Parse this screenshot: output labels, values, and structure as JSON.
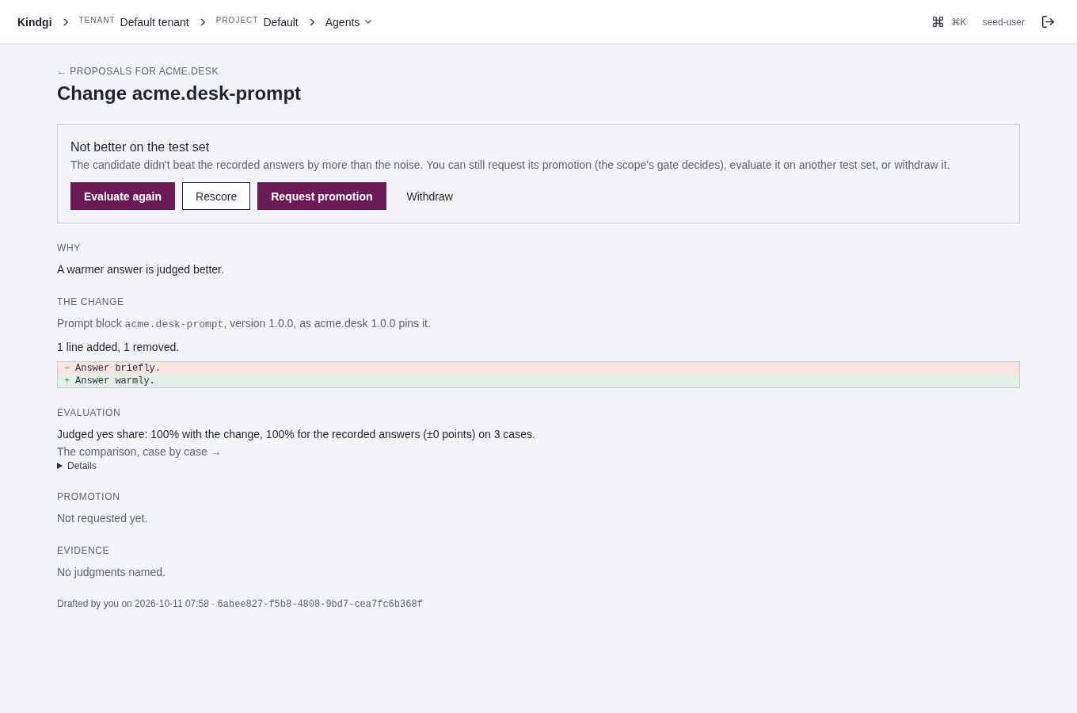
{
  "header": {
    "brand": "Kindgi",
    "breadcrumbs": [
      {
        "kind": "scoped",
        "label": "TENANT",
        "value": "Default tenant"
      },
      {
        "kind": "scoped",
        "label": "PROJECT",
        "value": "Default"
      },
      {
        "kind": "menu",
        "value": "Agents"
      }
    ],
    "shortcut": "⌘K",
    "user": "seed-user"
  },
  "back_link": "← PROPOSALS FOR ACME.DESK",
  "title": "Change acme.desk-prompt",
  "notice": {
    "title": "Not better on the test set",
    "text": "The candidate didn't beat the recorded answers by more than the noise. You can still request its promotion (the scope's gate decides), evaluate it on another test set, or withdraw it.",
    "buttons": [
      {
        "label": "Evaluate again",
        "kind": "primary"
      },
      {
        "label": "Rescore",
        "kind": "outline"
      },
      {
        "label": "Request promotion",
        "kind": "primary"
      },
      {
        "label": "Withdraw",
        "kind": "plain"
      }
    ]
  },
  "sections": [
    {
      "heading": "WHY",
      "kind": "text",
      "text": "A warmer answer is judged better."
    },
    {
      "heading": "THE CHANGE",
      "kind": "change",
      "description": [
        {
          "text": "Prompt block ",
          "code": false
        },
        {
          "text": "acme.desk-prompt",
          "code": true
        },
        {
          "text": ", version 1.0.0, as acme.desk 1.0.0 pins it.",
          "code": false
        }
      ],
      "summary": "1 line added, 1 removed.",
      "diff": [
        {
          "kind": "removed",
          "sign": "−",
          "text": "Answer briefly."
        },
        {
          "kind": "added",
          "sign": "+",
          "text": "Answer warmly."
        }
      ]
    },
    {
      "heading": "EVALUATION",
      "kind": "evaluation",
      "text": "Judged yes share: 100% with the change, 100% for the recorded answers (±0 points) on 3 cases.",
      "link": "The comparison, case by case →",
      "details": {
        "label": "Details",
        "expanded": false
      }
    },
    {
      "heading": "PROMOTION",
      "kind": "empty",
      "text": "Not requested yet."
    },
    {
      "heading": "EVIDENCE",
      "kind": "empty",
      "text": "No judgments named."
    }
  ],
  "footer": [
    {
      "text": "Drafted by you on 2026-10-11 07:58 · ",
      "code": false
    },
    {
      "text": "6abee827-f5b8-4808-9bd7-cea7fc6b368f",
      "code": true
    }
  ]
}
